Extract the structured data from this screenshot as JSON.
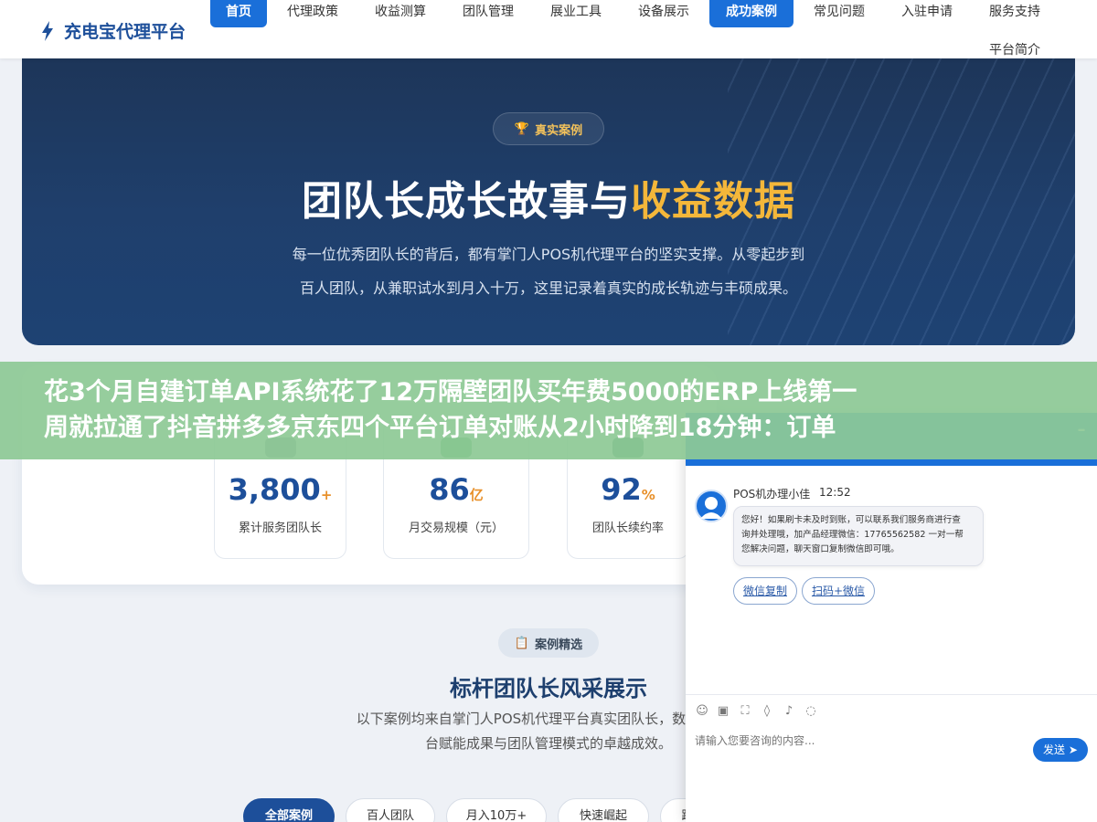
{
  "header": {
    "logo_text": "充电宝代理平台",
    "nav": [
      "首页",
      "代理政策",
      "收益测算",
      "团队管理",
      "展业工具",
      "设备展示",
      "成功案例",
      "常见问题",
      "入驻申请",
      "服务支持",
      "平台简介"
    ],
    "active_nav": [
      "首页",
      "成功案例"
    ]
  },
  "hero": {
    "badge": "真实案例",
    "title_main": "团队长成长故事与",
    "title_highlight": "收益数据",
    "desc_line1": "每一位优秀团队长的背后，都有掌门人POS机代理平台的坚实支撑。从零起步到",
    "desc_line2": "百人团队，从兼职试水到月入十万，这里记录着真实的成长轨迹与丰硕成果。"
  },
  "stats": [
    {
      "value": "3,800",
      "unit": "+",
      "label": "累计服务团队长",
      "icon_color": "#7b8796"
    },
    {
      "value": "86",
      "unit": "亿",
      "label": "月交易规模（元）",
      "icon_color": "#3aa95d"
    },
    {
      "value": "92",
      "unit": "%",
      "label": "团队长续约率",
      "icon_color": "#2f7b63"
    }
  ],
  "banner": {
    "line1": "花3个月自建订单API系统花了12万隔壁团队买年费5000的ERP上线第一",
    "line2": "周就拉通了抖音拼多多京东四个平台订单对账从2小时降到18分钟：订单"
  },
  "section": {
    "badge": "案例精选",
    "title": "标杆团队长风采展示",
    "desc_line1": "以下案例均来自掌门人POS机代理平台真实团队长，数据经本人",
    "desc_line2": "台赋能成果与团队管理模式的卓越成效。",
    "filters": [
      "全部案例",
      "百人团队",
      "月入10万+",
      "快速崛起",
      "跨"
    ]
  },
  "chat": {
    "agent_name": "POS机办理小佳",
    "time": "12:52",
    "message_line1": "您好！如果刷卡未及时到账，可以联系我们服务商进行查",
    "message_line2": "询并处理哦，加产品经理微信：17765562582 一对一帮",
    "message_line3": "您解决问题，聊天窗口复制微信即可哦。",
    "btn_copy": "微信复制",
    "btn_scan": "扫码+微信",
    "input_placeholder": "请输入您要咨询的内容...",
    "send_label": "发送",
    "close_symbol": "–"
  }
}
